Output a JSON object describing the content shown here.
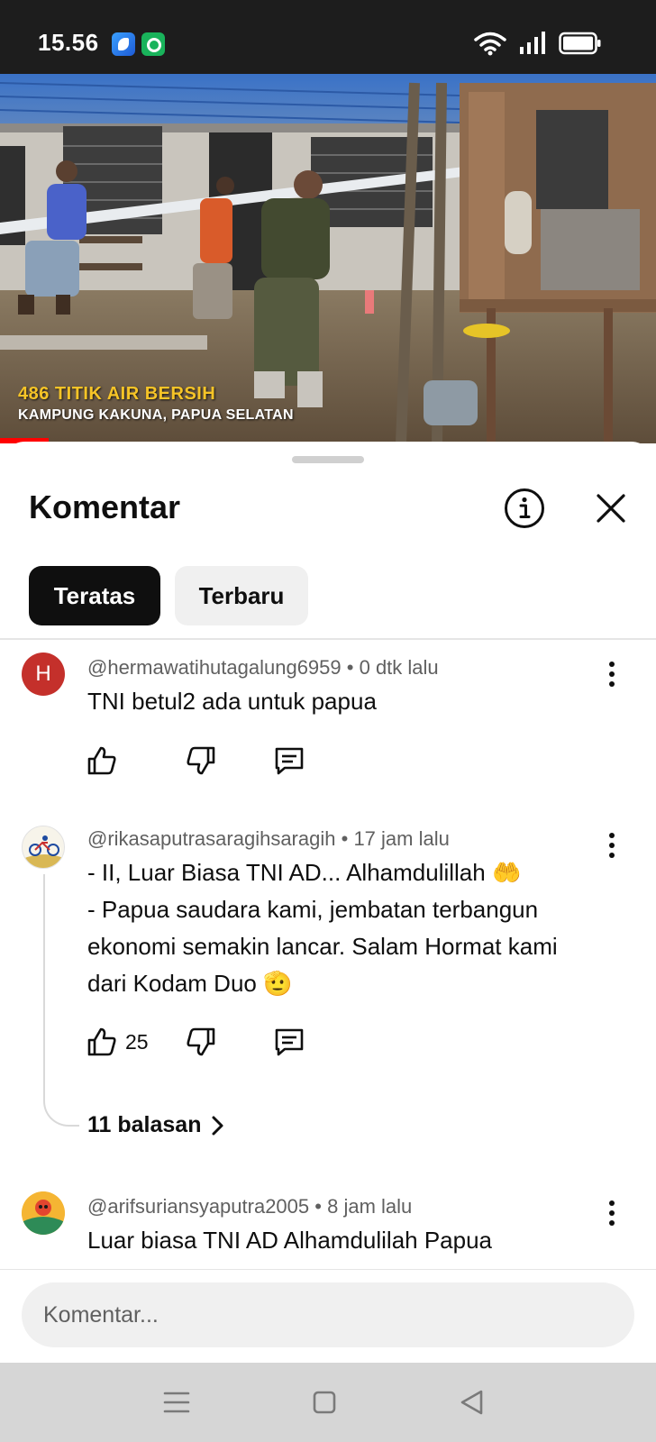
{
  "status_bar": {
    "time": "15.56",
    "icons": [
      "app-icon-blue",
      "app-icon-green",
      "wifi-icon",
      "signal-icon",
      "battery-icon"
    ]
  },
  "video": {
    "overlay_line1": "486 TITIK AIR BERSIH",
    "overlay_line2": "KAMPUNG KAKUNA, PAPUA SELATAN",
    "accent_color": "#ff0000"
  },
  "sheet": {
    "title": "Komentar",
    "tabs": [
      {
        "label": "Teratas",
        "active": true
      },
      {
        "label": "Terbaru",
        "active": false
      }
    ]
  },
  "comments": [
    {
      "author": "@hermawatihutagalung6959",
      "time": "0 dtk lalu",
      "avatar_letter": "H",
      "text": "TNI betul2 ada untuk papua",
      "likes": ""
    },
    {
      "author": "@rikasaputrasaragihsaragih",
      "time": "17 jam lalu",
      "text_lines": [
        "- II, Luar Biasa TNI AD... Alhamdulillah 🤲",
        "- Papua saudara kami, jembatan terbangun",
        "ekonomi semakin lancar. Salam Hormat kami",
        "dari Kodam Duo 🫡"
      ],
      "likes": "25",
      "replies": "11 balasan"
    },
    {
      "author": "@arifsuriansyaputra2005",
      "time": "8 jam lalu",
      "text": "Luar biasa TNI AD Alhamdulilah Papua"
    }
  ],
  "input": {
    "placeholder": "Komentar..."
  }
}
